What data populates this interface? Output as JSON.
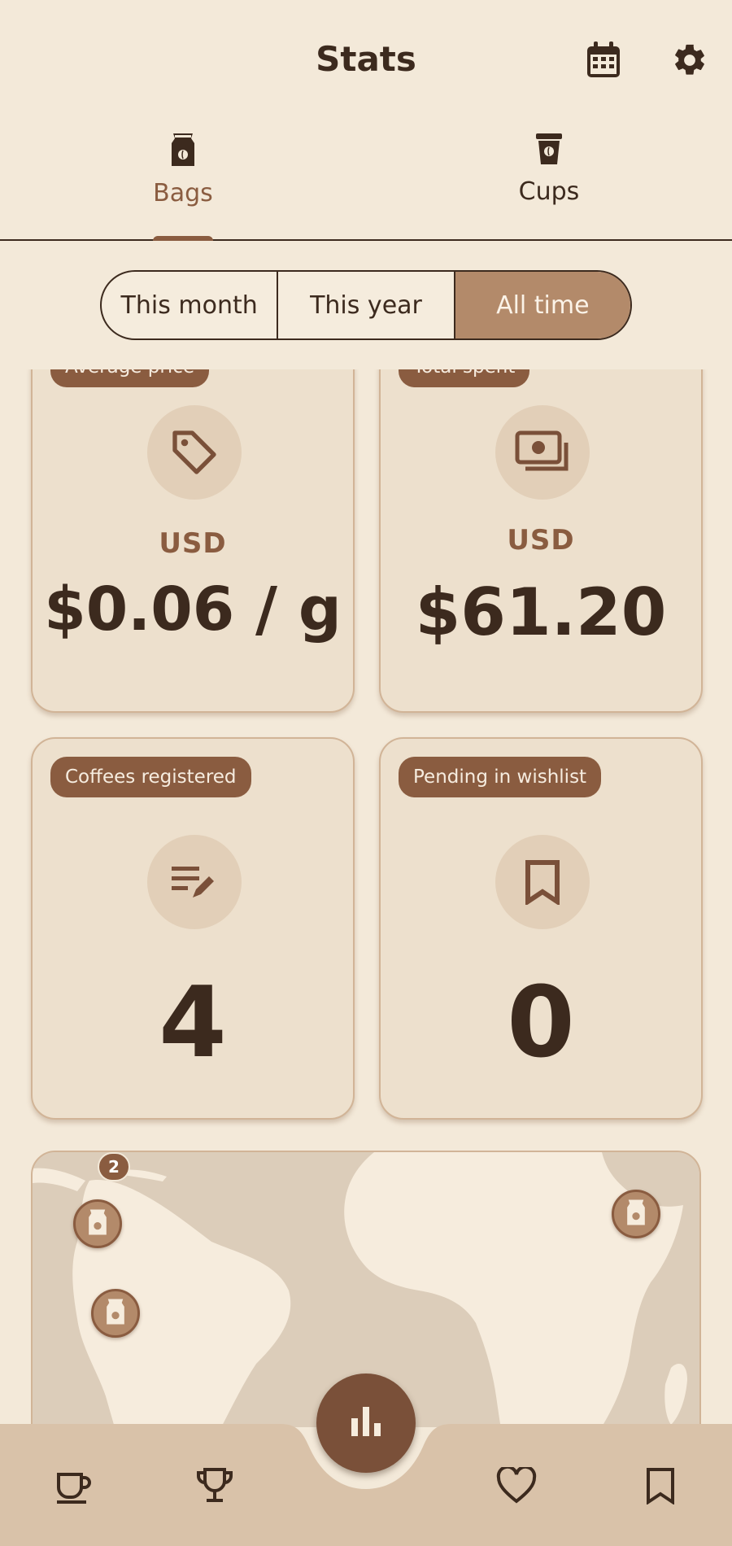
{
  "header": {
    "title": "Stats",
    "calendar_icon": "calendar-icon",
    "settings_icon": "gear-icon"
  },
  "tabs": [
    {
      "label": "Bags",
      "icon": "coffee-bag-icon",
      "active": true
    },
    {
      "label": "Cups",
      "icon": "coffee-cup-icon",
      "active": false
    }
  ],
  "period": {
    "options": [
      "This month",
      "This year",
      "All time"
    ],
    "selected": "All time"
  },
  "cards": {
    "average_price": {
      "chip": "Average price",
      "icon": "price-tag-icon",
      "currency": "USD",
      "value": "$0.06 / g"
    },
    "total_spent": {
      "chip": "Total spent",
      "icon": "money-icon",
      "currency": "USD",
      "value": "$61.20"
    },
    "coffees_registered": {
      "chip": "Coffees registered",
      "icon": "edit-list-icon",
      "value": "4"
    },
    "wishlist": {
      "chip": "Pending in wishlist",
      "icon": "bookmark-icon",
      "value": "0"
    }
  },
  "map": {
    "cluster_count": "2",
    "pin_icon": "coffee-bag-icon"
  },
  "nav": {
    "items": [
      "coffee-cup-icon",
      "trophy-icon",
      "stats-icon",
      "heart-icon",
      "bookmark-icon"
    ],
    "active": "stats-icon"
  },
  "colors": {
    "background": "#f3e9d9",
    "accent": "#8a5c40",
    "accent_light": "#b38a6a",
    "nav_bg": "#d9c2a9",
    "text": "#3c2a1e"
  }
}
